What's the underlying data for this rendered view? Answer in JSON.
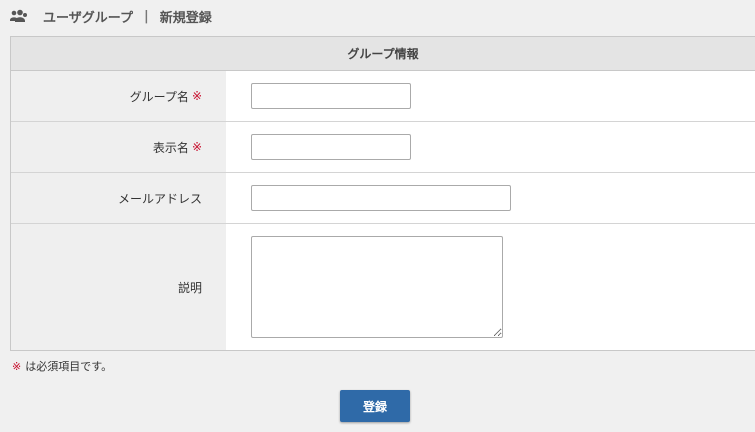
{
  "header": {
    "icon": "users-icon",
    "section": "ユーザグループ",
    "separator": "|",
    "title": "新規登録"
  },
  "form": {
    "heading": "グループ情報",
    "required_mark": "※",
    "fields": [
      {
        "label": "グループ名",
        "required": true,
        "value": ""
      },
      {
        "label": "表示名",
        "required": true,
        "value": ""
      },
      {
        "label": "メールアドレス",
        "required": false,
        "value": ""
      },
      {
        "label": "説明",
        "required": false,
        "value": ""
      }
    ]
  },
  "note": {
    "mark": "※",
    "text": "は必須項目です。"
  },
  "submit_label": "登録",
  "colors": {
    "accent": "#2f6aa8",
    "required": "#c8102e"
  }
}
